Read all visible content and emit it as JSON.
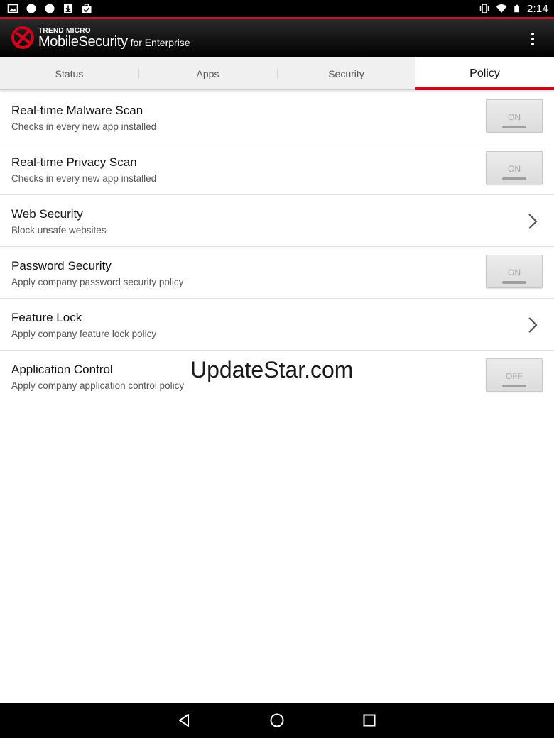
{
  "status_bar": {
    "time": "2:14",
    "left_icons": [
      "image-icon",
      "dot-icon",
      "dot-icon",
      "download-icon",
      "briefcase-icon"
    ],
    "right_icons": [
      "vibrate-icon",
      "wifi-icon",
      "battery-icon"
    ]
  },
  "app_bar": {
    "brand_top": "TREND MICRO",
    "brand_main": "MobileSecurity",
    "brand_suffix": "for Enterprise",
    "accent_color": "#d6001c",
    "menu_icon": "overflow-menu-icon"
  },
  "tabs": [
    {
      "label": "Status",
      "active": false
    },
    {
      "label": "Apps",
      "active": false
    },
    {
      "label": "Security",
      "active": false
    },
    {
      "label": "Policy",
      "active": true
    }
  ],
  "policy_items": [
    {
      "title": "Real-time Malware Scan",
      "subtitle": "Checks in every new app installed",
      "control": "toggle",
      "value": "ON"
    },
    {
      "title": "Real-time Privacy Scan",
      "subtitle": "Checks in every new app installed",
      "control": "toggle",
      "value": "ON"
    },
    {
      "title": "Web Security",
      "subtitle": "Block unsafe websites",
      "control": "chevron",
      "value": "chevron-right-icon"
    },
    {
      "title": "Password Security",
      "subtitle": "Apply company password security policy",
      "control": "toggle",
      "value": "ON"
    },
    {
      "title": "Feature Lock",
      "subtitle": "Apply company feature lock policy",
      "control": "chevron",
      "value": "chevron-right-icon"
    },
    {
      "title": "Application Control",
      "subtitle": "Apply company application control policy",
      "control": "toggle",
      "value": "OFF"
    }
  ],
  "watermark": "UpdateStar.com",
  "nav_bar": [
    "back-icon",
    "home-icon",
    "recents-icon"
  ]
}
